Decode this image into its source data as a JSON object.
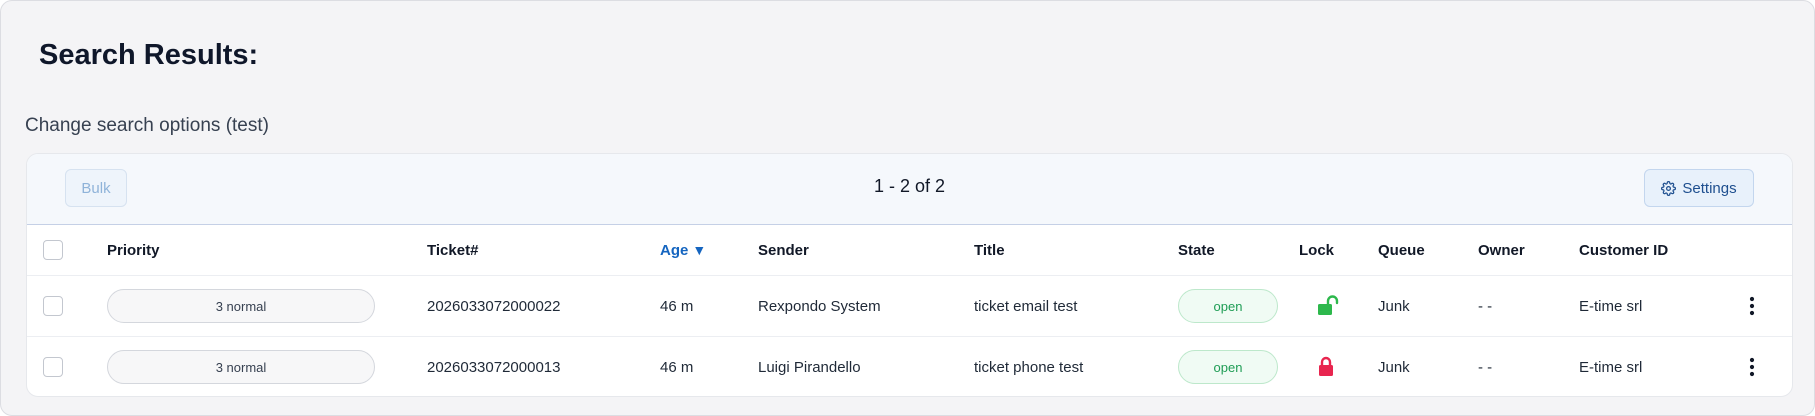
{
  "page": {
    "title": "Search Results:",
    "search_options_link": "Change search options (test)"
  },
  "toolbar": {
    "bulk_label": "Bulk",
    "pagination": "1 - 2 of 2",
    "settings_label": "Settings"
  },
  "table": {
    "columns": {
      "priority": "Priority",
      "ticket": "Ticket#",
      "age": "Age",
      "age_sort_indicator": "▼",
      "sender": "Sender",
      "title": "Title",
      "state": "State",
      "lock": "Lock",
      "queue": "Queue",
      "owner": "Owner",
      "customer_id": "Customer ID"
    },
    "sorted_column": "Age",
    "sort_direction": "descending",
    "rows": [
      {
        "priority": "3 normal",
        "ticket": "2026033072000022",
        "age": "46 m",
        "sender": "Rexpondo System",
        "title": "ticket email test",
        "state": "open",
        "lock": "unlocked-icon",
        "queue": "Junk",
        "owner": "- -",
        "customer_id": "E-time srl"
      },
      {
        "priority": "3 normal",
        "ticket": "2026033072000013",
        "age": "46 m",
        "sender": "Luigi Pirandello",
        "title": "ticket phone test",
        "state": "open",
        "lock": "locked-icon",
        "queue": "Junk",
        "owner": "- -",
        "customer_id": "E-time srl"
      }
    ]
  },
  "colors": {
    "accent_blue": "#1565c0",
    "state_open": "#1f9d55",
    "unlocked": "#2db84c",
    "locked": "#e8254f"
  }
}
